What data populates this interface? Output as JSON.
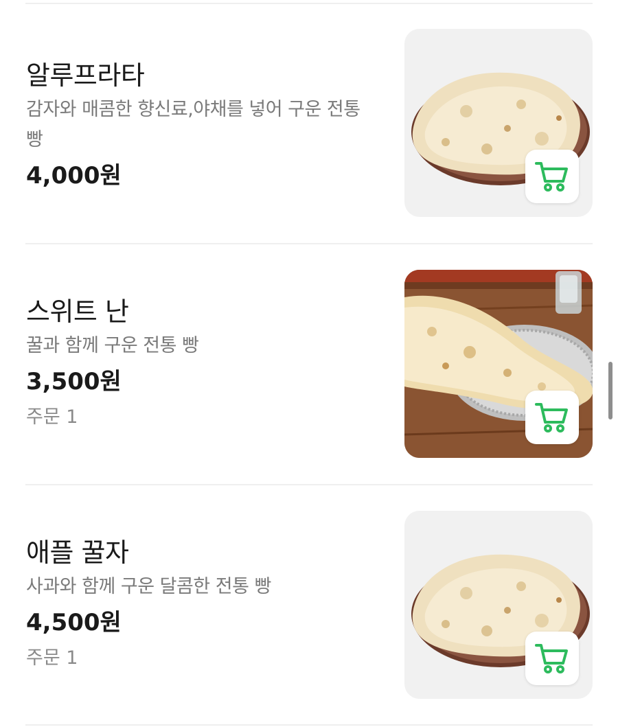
{
  "menu_items": [
    {
      "name": "알루프라타",
      "description": "감자와 매콤한 향신료,야채를 넣어 구운 전통 빵",
      "price": "4,000원",
      "orders": "",
      "photo": "flatbread-on-plate"
    },
    {
      "name": "스위트 난",
      "description": "꿀과 함께 구운 전통 빵",
      "price": "3,500원",
      "orders": "주문 1",
      "photo": "naan-on-wooden-table"
    },
    {
      "name": "애플 꿀자",
      "description": "사과와 함께 구운 달콤한 전통 빵",
      "price": "4,500원",
      "orders": "주문 1",
      "photo": "flatbread-on-plate"
    }
  ],
  "colors": {
    "accent_green": "#2dbb5d",
    "divider": "#efefef",
    "secondary_text": "#7a7a7a"
  },
  "icons": {
    "cart": "shopping-cart-icon"
  }
}
